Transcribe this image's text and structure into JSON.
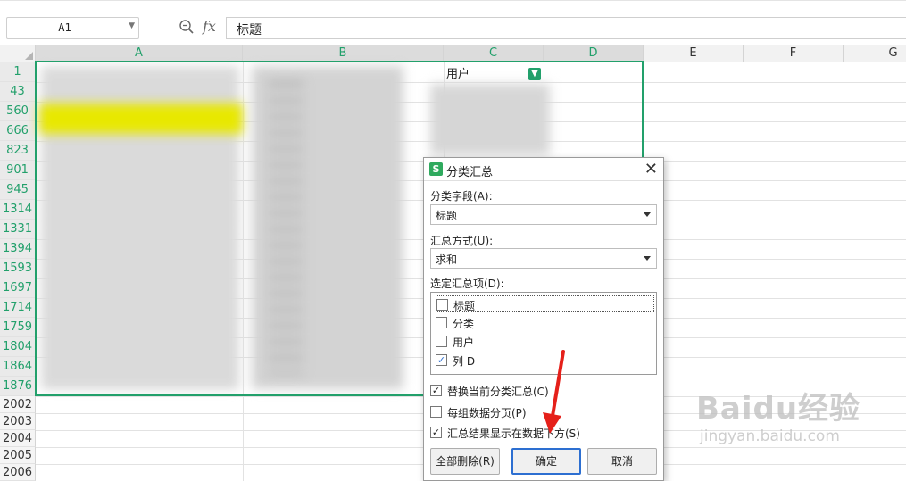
{
  "formula_bar": {
    "cell_ref": "A1",
    "fx_label": "fx",
    "content": "标题"
  },
  "columns": [
    "A",
    "B",
    "C",
    "D",
    "E",
    "F",
    "G"
  ],
  "rows": [
    "1",
    "43",
    "560",
    "666",
    "823",
    "901",
    "945",
    "1314",
    "1331",
    "1394",
    "1593",
    "1697",
    "1714",
    "1759",
    "1804",
    "1864",
    "1876",
    "2002",
    "2003",
    "2004",
    "2005",
    "2006"
  ],
  "cells": {
    "c1": "用户"
  },
  "dialog": {
    "logo": "S",
    "title": "分类汇总",
    "group_field_label": "分类字段(A):",
    "group_field_value": "标题",
    "summary_method_label": "汇总方式(U):",
    "summary_method_value": "求和",
    "summary_items_label": "选定汇总项(D):",
    "summary_items": [
      {
        "label": "标题",
        "checked": false
      },
      {
        "label": "分类",
        "checked": false
      },
      {
        "label": "用户",
        "checked": false
      },
      {
        "label": "列 D",
        "checked": true
      }
    ],
    "options": [
      {
        "label": "替换当前分类汇总(C)",
        "checked": true
      },
      {
        "label": "每组数据分页(P)",
        "checked": false
      },
      {
        "label": "汇总结果显示在数据下方(S)",
        "checked": true
      }
    ],
    "btn_delete_all": "全部删除(R)",
    "btn_ok": "确定",
    "btn_cancel": "取消"
  },
  "watermark": {
    "line1": "Baidu经验",
    "line2": "jingyan.baidu.com"
  },
  "colors": {
    "selection": "#22a06b",
    "highlight_yellow": "#e8e800",
    "accent_blue": "#2d6fd1",
    "arrow_red": "#e5201a"
  }
}
